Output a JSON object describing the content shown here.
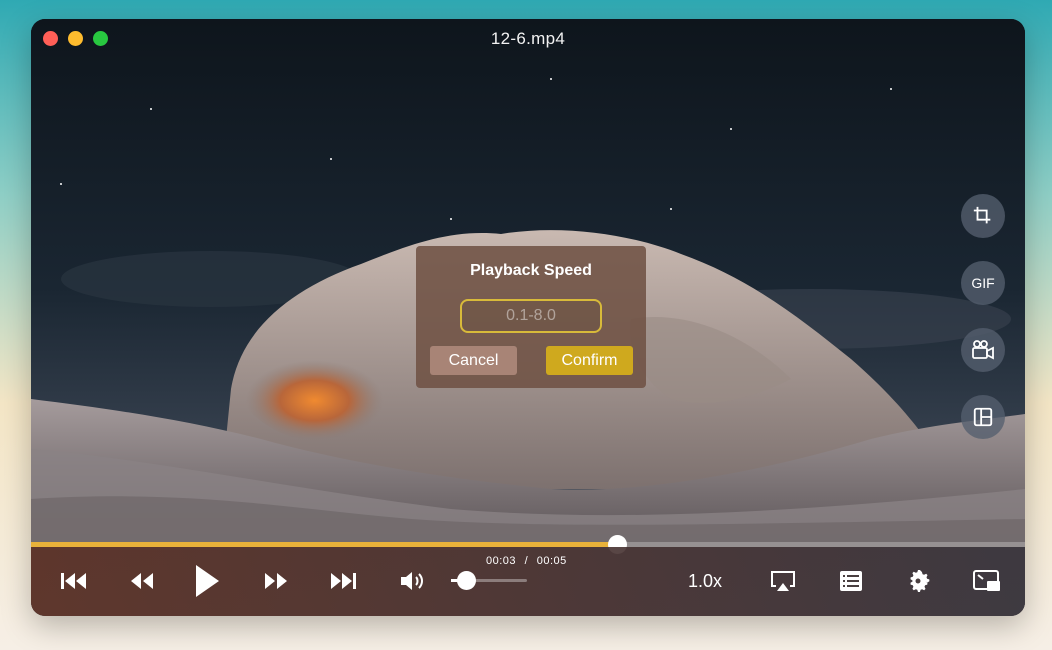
{
  "window": {
    "title": "12-6.mp4"
  },
  "side_tools": [
    {
      "name": "crop-icon",
      "label": ""
    },
    {
      "name": "gif-icon",
      "label": "GIF"
    },
    {
      "name": "video-camera-icon",
      "label": ""
    },
    {
      "name": "layout-icon",
      "label": ""
    }
  ],
  "dialog": {
    "title": "Playback Speed",
    "input_placeholder": "0.1-8.0",
    "input_value": "",
    "cancel_label": "Cancel",
    "confirm_label": "Confirm"
  },
  "playback": {
    "current_time": "00:03",
    "separator": "/",
    "total_time": "00:05",
    "progress_fraction": 0.59,
    "volume_fraction": 0.2,
    "speed": "1.0x"
  },
  "colors": {
    "accent": "#e9b23a",
    "confirm": "#cfa91e",
    "cancel": "#a88476"
  }
}
